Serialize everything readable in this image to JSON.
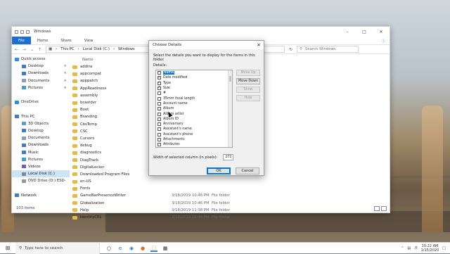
{
  "explorer": {
    "title": "Windows",
    "ribbon_tabs": [
      "File",
      "Home",
      "Share",
      "View"
    ],
    "breadcrumb": [
      "This PC",
      "Local Disk (C:)",
      "Windows"
    ],
    "search_placeholder": "Search Windows",
    "column_name": "Name",
    "status": "103 items",
    "nav": [
      {
        "label": "Quick access",
        "icon": "star-icon",
        "color": "#1e90ff"
      },
      {
        "label": "Desktop",
        "icon": "desktop-icon",
        "color": "#3a7bd5",
        "pinned": true
      },
      {
        "label": "Downloads",
        "icon": "download-icon",
        "color": "#3a7bd5",
        "pinned": true
      },
      {
        "label": "Documents",
        "icon": "document-icon",
        "color": "#8aa0b8",
        "pinned": true
      },
      {
        "label": "Pictures",
        "icon": "picture-icon",
        "color": "#3aa0d5",
        "pinned": true
      },
      {
        "label": "",
        "icon": "blank",
        "color": "#ffffff"
      },
      {
        "label": "OneDrive",
        "icon": "cloud-icon",
        "color": "#1e90ff"
      },
      {
        "label": "",
        "icon": "blank",
        "color": "#ffffff"
      },
      {
        "label": "This PC",
        "icon": "computer-icon",
        "color": "#3a7bd5"
      },
      {
        "label": "3D Objects",
        "icon": "cube-icon",
        "color": "#5aa0d5"
      },
      {
        "label": "Desktop",
        "icon": "desktop-icon",
        "color": "#3a7bd5"
      },
      {
        "label": "Documents",
        "icon": "document-icon",
        "color": "#8aa0b8"
      },
      {
        "label": "Downloads",
        "icon": "download-icon",
        "color": "#3a7bd5"
      },
      {
        "label": "Music",
        "icon": "music-icon",
        "color": "#3a7bd5"
      },
      {
        "label": "Pictures",
        "icon": "picture-icon",
        "color": "#3aa0d5"
      },
      {
        "label": "Videos",
        "icon": "video-icon",
        "color": "#6b5bd5"
      },
      {
        "label": "Local Disk (C:)",
        "icon": "drive-icon",
        "color": "#888888",
        "selected": true
      },
      {
        "label": "DVD Drive (D:) ESD-",
        "icon": "dvd-icon",
        "color": "#999999"
      },
      {
        "label": "",
        "icon": "blank",
        "color": "#ffffff"
      },
      {
        "label": "Network",
        "icon": "network-icon",
        "color": "#3a7bd5"
      }
    ],
    "files": [
      {
        "name": "addins",
        "date": "",
        "type": ""
      },
      {
        "name": "appcompat",
        "date": "",
        "type": ""
      },
      {
        "name": "apppatch",
        "date": "",
        "type": ""
      },
      {
        "name": "AppReadiness",
        "date": "",
        "type": ""
      },
      {
        "name": "assembly",
        "date": "",
        "type": ""
      },
      {
        "name": "bcastdvr",
        "date": "",
        "type": ""
      },
      {
        "name": "Boot",
        "date": "",
        "type": ""
      },
      {
        "name": "Branding",
        "date": "",
        "type": ""
      },
      {
        "name": "CbsTemp",
        "date": "",
        "type": ""
      },
      {
        "name": "CSC",
        "date": "",
        "type": ""
      },
      {
        "name": "Cursors",
        "date": "",
        "type": ""
      },
      {
        "name": "debug",
        "date": "",
        "type": ""
      },
      {
        "name": "diagnostics",
        "date": "",
        "type": ""
      },
      {
        "name": "DiagTrack",
        "date": "",
        "type": ""
      },
      {
        "name": "DigitalLocker",
        "date": "",
        "type": ""
      },
      {
        "name": "Downloaded Program Files",
        "date": "",
        "type": ""
      },
      {
        "name": "en-US",
        "date": "",
        "type": ""
      },
      {
        "name": "Fonts",
        "date": "",
        "type": ""
      },
      {
        "name": "GameBarPresenceWriter",
        "date": "3/18/2019 10:46 PM",
        "type": "File folder"
      },
      {
        "name": "Globalization",
        "date": "3/18/2019 10:46 PM",
        "type": "File folder"
      },
      {
        "name": "Help",
        "date": "3/18/2019 11:38 PM",
        "type": "File folder"
      },
      {
        "name": "IdentityCRL",
        "date": "3/18/2019 10:46 PM",
        "type": "File folder"
      }
    ]
  },
  "dialog": {
    "title": "Choose Details",
    "instruction": "Select the details you want to display for the items in this folder.",
    "details_label": "Details:",
    "details": [
      {
        "label": "Name",
        "checked": true,
        "selected": true
      },
      {
        "label": "Date modified",
        "checked": true
      },
      {
        "label": "Type",
        "checked": true
      },
      {
        "label": "Size",
        "checked": true
      },
      {
        "label": "#",
        "checked": false
      },
      {
        "label": "35mm focal length",
        "checked": false
      },
      {
        "label": "Account name",
        "checked": false
      },
      {
        "label": "Album",
        "checked": false
      },
      {
        "label": "Album artist",
        "checked": false
      },
      {
        "label": "Album ID",
        "checked": false
      },
      {
        "label": "Anniversary",
        "checked": false
      },
      {
        "label": "Assistant's name",
        "checked": false
      },
      {
        "label": "Assistant's phone",
        "checked": false
      },
      {
        "label": "Attachments",
        "checked": false
      },
      {
        "label": "Attributes",
        "checked": false
      }
    ],
    "buttons": {
      "move_up": "Move Up",
      "move_down": "Move Down",
      "show": "Show",
      "hide": "Hide",
      "ok": "OK",
      "cancel": "Cancel"
    },
    "width_label": "Width of selected column (in pixels):",
    "width_value": "272"
  },
  "taskbar": {
    "search_placeholder": "Type here to search",
    "time": "10:22 AM",
    "date": "1/15/2020"
  }
}
